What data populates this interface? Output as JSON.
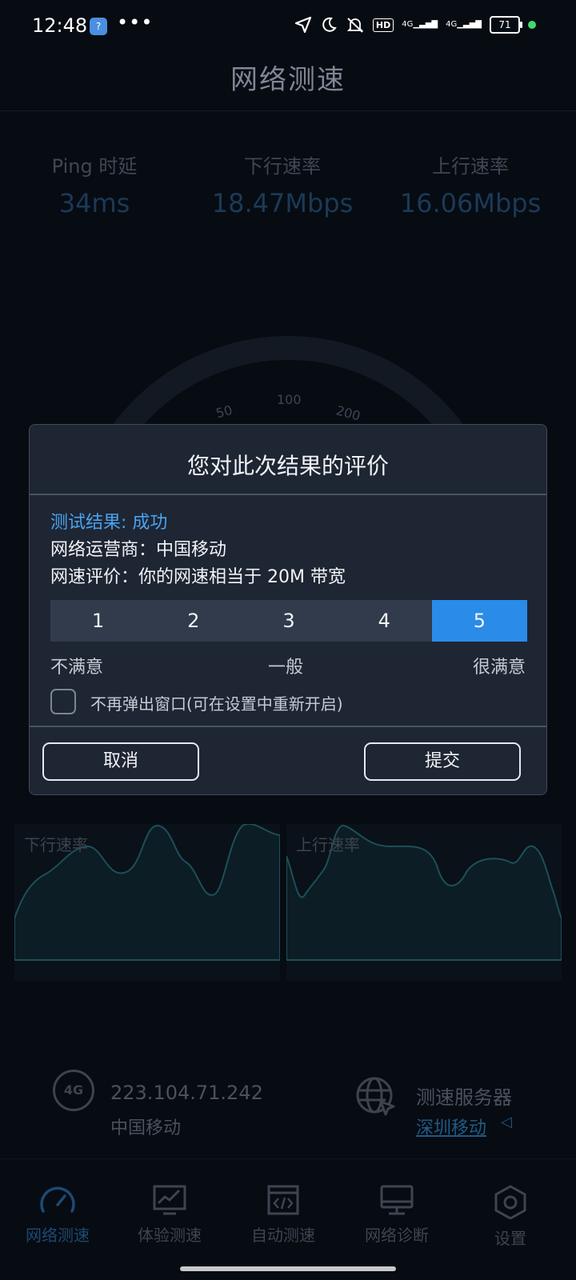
{
  "status_bar": {
    "time": "12:48",
    "dots": "•••",
    "hd_badge": "HD",
    "network_1": "4G",
    "network_2": "4G",
    "battery": "71"
  },
  "app": {
    "title": "网络测速"
  },
  "stats": [
    {
      "label": "Ping 时延",
      "value": "34ms"
    },
    {
      "label": "下行速率",
      "value": "18.47Mbps"
    },
    {
      "label": "上行速率",
      "value": "16.06Mbps"
    }
  ],
  "gauge": {
    "ticks": [
      "50",
      "100",
      "200"
    ]
  },
  "charts": {
    "download_label": "下行速率",
    "upload_label": "上行速率"
  },
  "connection": {
    "network_icon_text": "4G",
    "ip": "223.104.71.242",
    "carrier": "中国移动",
    "server_title": "测速服务器",
    "server_name": "深圳移动",
    "server_arrow": "◁"
  },
  "nav": [
    {
      "label": "网络测速",
      "icon": "speedometer-icon",
      "active": true
    },
    {
      "label": "体验测速",
      "icon": "experience-chart-icon",
      "active": false
    },
    {
      "label": "自动测速",
      "icon": "auto-test-icon",
      "active": false
    },
    {
      "label": "网络诊断",
      "icon": "monitor-icon",
      "active": false
    },
    {
      "label": "设置",
      "icon": "settings-icon",
      "active": false
    }
  ],
  "dialog": {
    "title": "您对此次结果的评价",
    "result": "测试结果: 成功",
    "carrier": "网络运营商：中国移动",
    "speed_eval": "网速评价：你的网速相当于 20M 带宽",
    "rating_options": [
      "1",
      "2",
      "3",
      "4",
      "5"
    ],
    "selected_rating": "5",
    "scale_low": "不满意",
    "scale_mid": "一般",
    "scale_high": "很满意",
    "checkbox_label": "不再弹出窗口(可在设置中重新开启)",
    "checkbox_checked": false,
    "cancel_label": "取消",
    "submit_label": "提交"
  },
  "colors": {
    "accent": "#2a8be8",
    "result_text": "#4aa3ef",
    "dialog_bg": "#1e2533",
    "page_bg": "#070b12"
  }
}
